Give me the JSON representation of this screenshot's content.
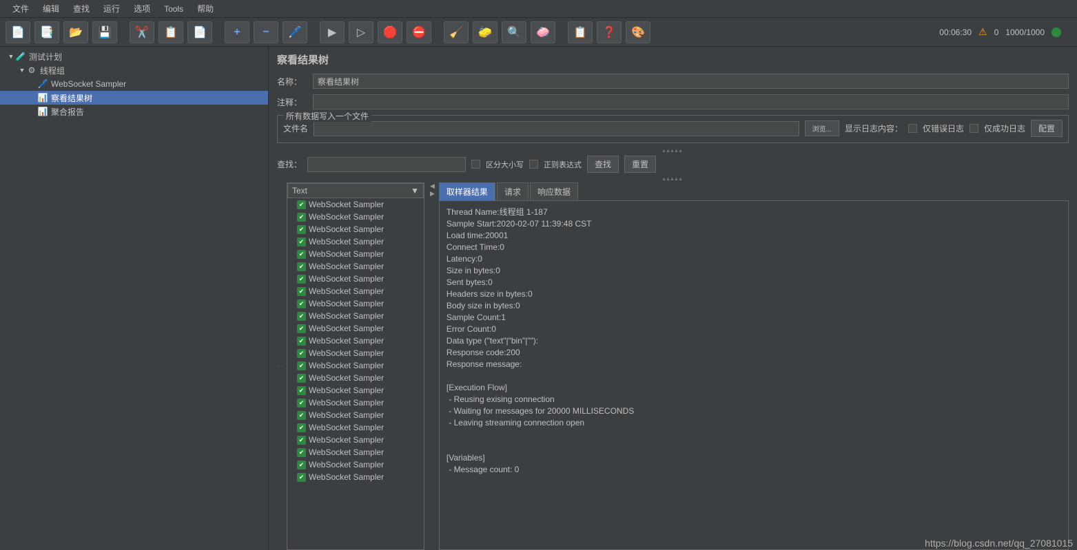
{
  "menu": {
    "items": [
      "文件",
      "编辑",
      "查找",
      "运行",
      "选项",
      "Tools",
      "帮助"
    ]
  },
  "toolbar_status": {
    "time": "00:06:30",
    "warn_count": "0",
    "threads": "1000/1000"
  },
  "tree": {
    "root": {
      "label": "测试计划"
    },
    "group": {
      "label": "线程组"
    },
    "children": [
      {
        "label": "WebSocket Sampler",
        "selected": false
      },
      {
        "label": "察看结果树",
        "selected": true
      },
      {
        "label": "聚合报告",
        "selected": false
      }
    ]
  },
  "panel": {
    "title": "察看结果树",
    "name_label": "名称：",
    "name_value": "察看结果树",
    "comment_label": "注释：",
    "comment_value": "",
    "fieldset_legend": "所有数据写入一个文件",
    "filename_label": "文件名",
    "browse": "浏览...",
    "log_content_label": "显示日志内容：",
    "only_error": "仅错误日志",
    "only_success": "仅成功日志",
    "configure": "配置",
    "search": {
      "label": "查找：",
      "case": "区分大小写",
      "regex": "正则表达式",
      "find": "查找",
      "reset": "重置"
    },
    "format_select": "Text",
    "tabs": [
      "取样器结果",
      "请求",
      "响应数据"
    ],
    "sampler_name": "WebSocket Sampler",
    "detail": "Thread Name:线程组 1-187\nSample Start:2020-02-07 11:39:48 CST\nLoad time:20001\nConnect Time:0\nLatency:0\nSize in bytes:0\nSent bytes:0\nHeaders size in bytes:0\nBody size in bytes:0\nSample Count:1\nError Count:0\nData type (\"text\"|\"bin\"|\"\"):\nResponse code:200\nResponse message:\n\n[Execution Flow]\n - Reusing exising connection\n - Waiting for messages for 20000 MILLISECONDS\n - Leaving streaming connection open\n\n\n[Variables]\n - Message count: 0"
  },
  "watermark": "https://blog.csdn.net/qq_27081015"
}
